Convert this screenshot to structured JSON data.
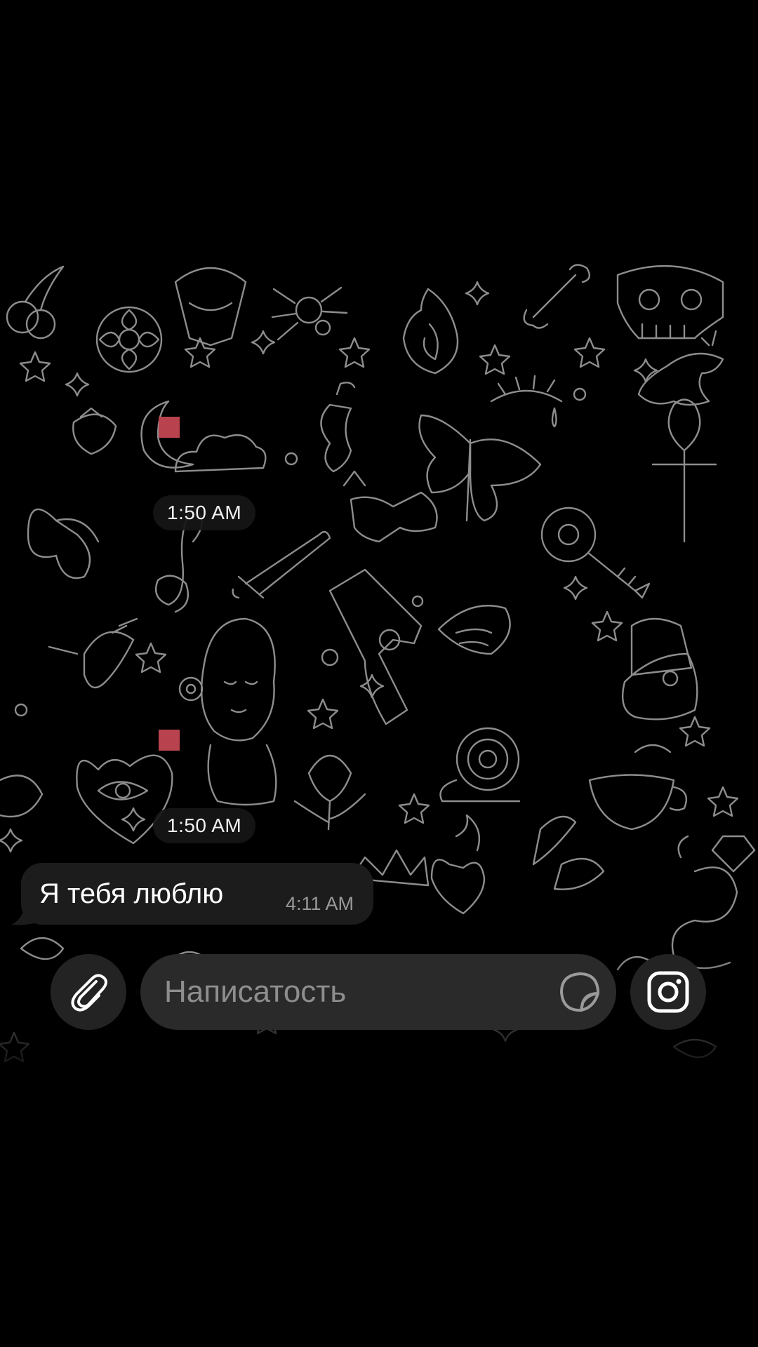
{
  "chat": {
    "date_separators": [
      {
        "time": "1:50 AM"
      },
      {
        "time": "1:50 AM"
      }
    ],
    "messages": [
      {
        "text": "Я тебя люблю",
        "time": "4:11 AM",
        "direction": "incoming"
      }
    ]
  },
  "composer": {
    "placeholder": "Написатость",
    "attach_icon": "paperclip-icon",
    "sticker_icon": "sticker-icon",
    "camera_icon": "instagram-camera-icon"
  },
  "colors": {
    "background": "#000000",
    "doodle_stroke": "#8d8d8d",
    "bubble": "#1c1c1c",
    "input": "#2a2a2a",
    "marker": "#b8434f"
  }
}
